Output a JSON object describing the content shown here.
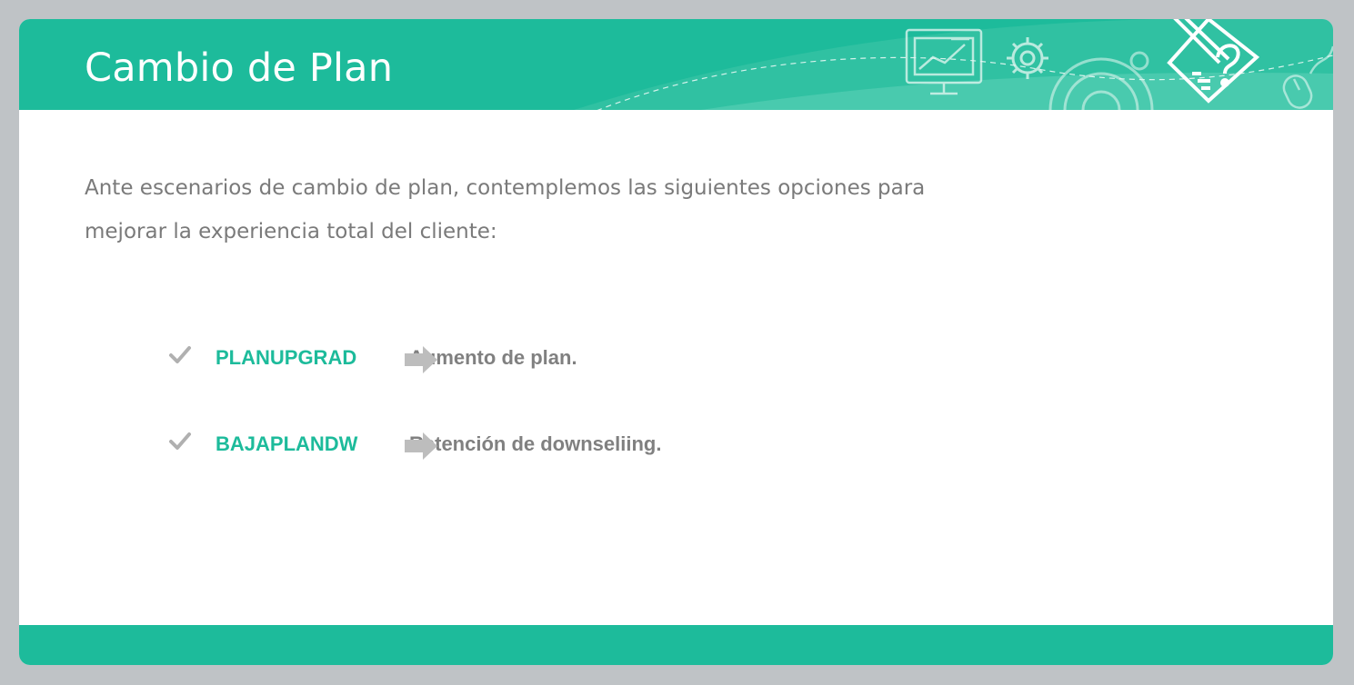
{
  "slide": {
    "title": "Cambio de Plan",
    "intro": "Ante escenarios de cambio de plan, contemplemos las siguientes opciones para mejorar la experiencia total del cliente:",
    "options": [
      {
        "code": "PLANUPGRAD",
        "description": "Aumento de plan."
      },
      {
        "code": "BAJAPLANDW",
        "description": "Retención de downseliing."
      }
    ]
  },
  "icons": [
    "check-icon",
    "arrow-right-icon",
    "presentation-screen-icon",
    "gear-icon",
    "mouse-icon",
    "pencil-question-icon"
  ],
  "colors": {
    "accent": "#1dbb9b",
    "accent_light": "#52cdb2",
    "body_text": "#7a7a7a",
    "option_text": "#808080",
    "frame": "#bfc3c6"
  }
}
